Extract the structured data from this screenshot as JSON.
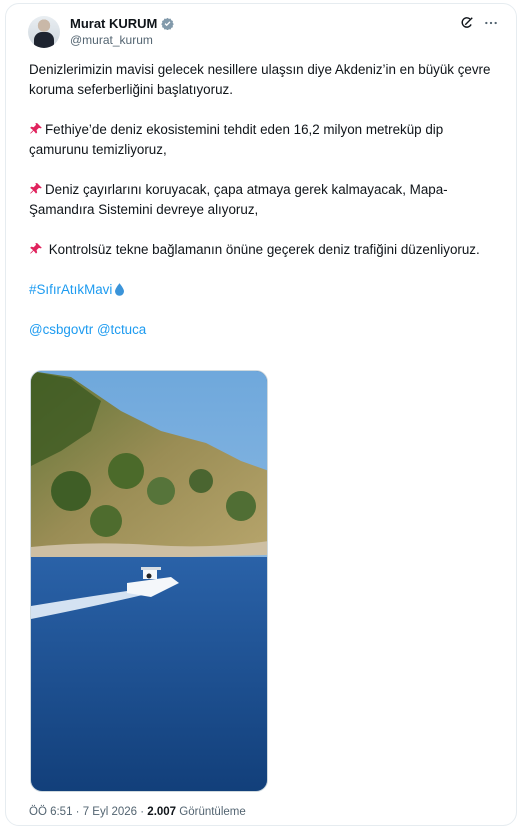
{
  "author": {
    "name": "Murat KURUM",
    "handle": "@murat_kurum",
    "verified": true
  },
  "header_icons": [
    "grok-icon",
    "more-icon"
  ],
  "tweet": {
    "p1": "Denizlerimizin mavisi gelecek nesillere ulaşsın diye Akdeniz’in en büyük çevre koruma seferberliğini başlatıyoruz.",
    "p2": "Fethiye’de deniz ekosistemini tehdit eden 16,2 milyon metreküp dip çamurunu temizliyoruz,",
    "p3": "Deniz çayırlarını koruyacak, çapa atmaya gerek kalmayacak, Mapa-Şamandıra Sistemini devreye alıyoruz,",
    "p4": " Kontrolsüz tekne bağlamanın önüne geçerek deniz trafiğini düzenliyoruz.",
    "hashtag": "#SıfırAtıkMavi",
    "mention1": "@csbgovtr",
    "mention2": "@tctuca"
  },
  "footer": {
    "time": "ÖÖ 6:51",
    "sep": " · ",
    "date": "7 Eyl 2026",
    "sep2": " · ",
    "views": "2.007",
    "views_label": " Görüntüleme"
  },
  "colors": {
    "link": "#1d9bf0",
    "pin": "#e0245e",
    "verified": "#829aab"
  }
}
